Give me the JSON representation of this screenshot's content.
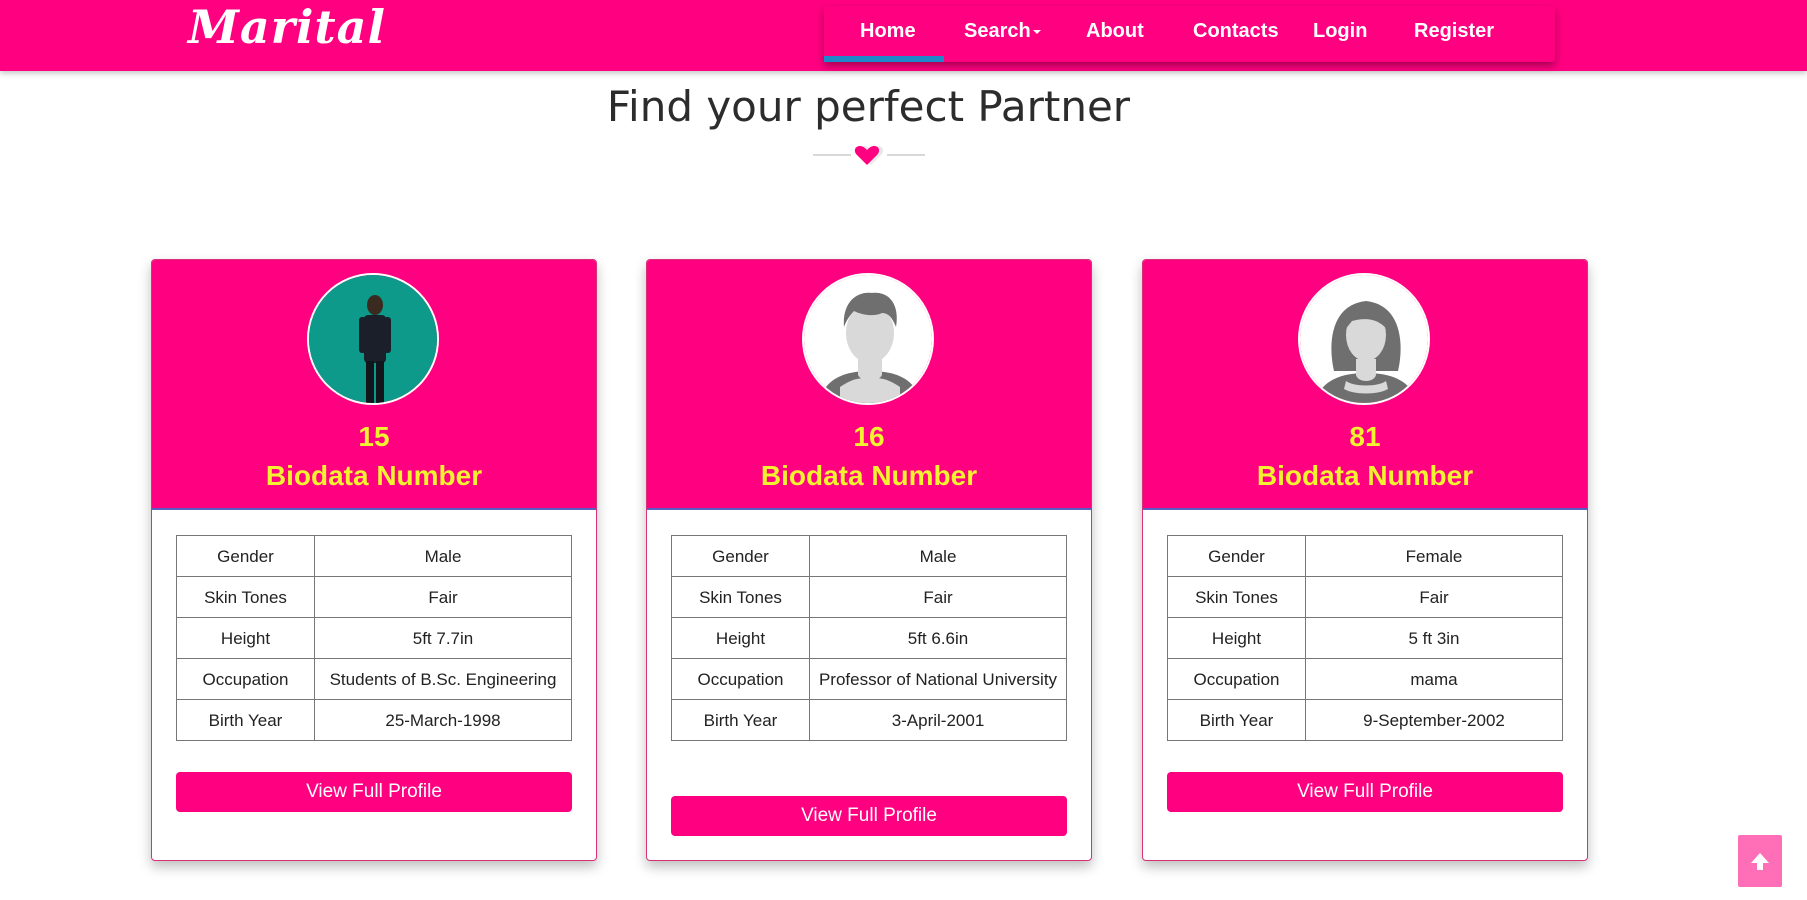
{
  "brand": "Marital",
  "nav": {
    "home": "Home",
    "search": "Search",
    "about": "About",
    "contacts": "Contacts",
    "login": "Login",
    "register": "Register"
  },
  "heading": "Find your perfect Partner",
  "colors": {
    "primary": "#ff0080",
    "accent_text": "#f2f230",
    "active_bar": "#1e88c8"
  },
  "cards": [
    {
      "biodata_number": "15",
      "label": "Biodata Number",
      "avatar": "photo-avatar",
      "rows": [
        {
          "key": "Gender",
          "value": "Male"
        },
        {
          "key": "Skin Tones",
          "value": "Fair"
        },
        {
          "key": "Height",
          "value": "5ft 7.7in"
        },
        {
          "key": "Occupation",
          "value": "Students of B.Sc. Engineering"
        },
        {
          "key": "Birth Year",
          "value": "25-March-1998"
        }
      ],
      "button": "View Full Profile"
    },
    {
      "biodata_number": "16",
      "label": "Biodata Number",
      "avatar": "male-silhouette-icon",
      "rows": [
        {
          "key": "Gender",
          "value": "Male"
        },
        {
          "key": "Skin Tones",
          "value": "Fair"
        },
        {
          "key": "Height",
          "value": "5ft 6.6in"
        },
        {
          "key": "Occupation",
          "value": "Professor of National University"
        },
        {
          "key": "Birth Year",
          "value": "3-April-2001"
        }
      ],
      "button": "View Full Profile"
    },
    {
      "biodata_number": "81",
      "label": "Biodata Number",
      "avatar": "female-silhouette-icon",
      "rows": [
        {
          "key": "Gender",
          "value": "Female"
        },
        {
          "key": "Skin Tones",
          "value": "Fair"
        },
        {
          "key": "Height",
          "value": "5 ft 3in"
        },
        {
          "key": "Occupation",
          "value": "mama"
        },
        {
          "key": "Birth Year",
          "value": "9-September-2002"
        }
      ],
      "button": "View Full Profile"
    }
  ]
}
